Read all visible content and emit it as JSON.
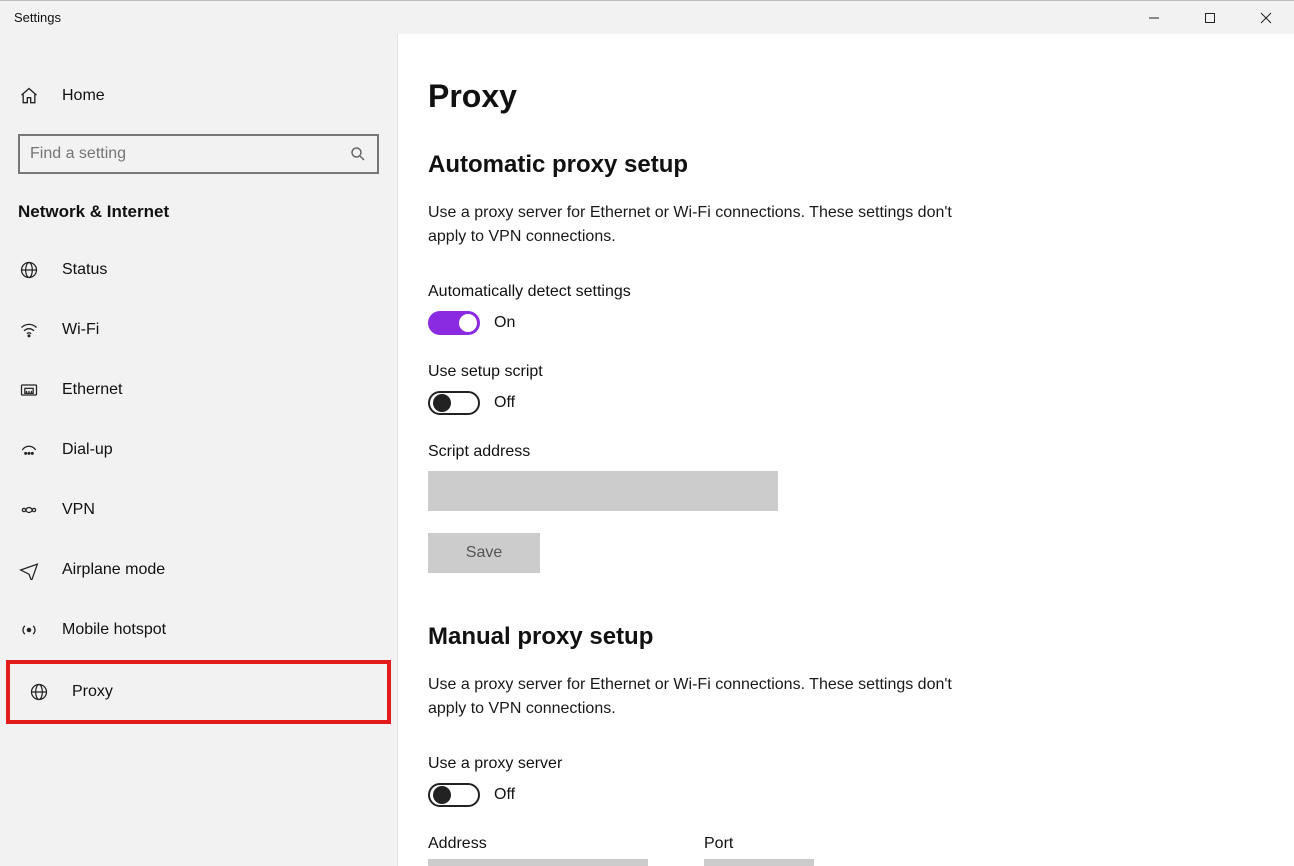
{
  "window": {
    "title": "Settings"
  },
  "sidebar": {
    "home": "Home",
    "search_placeholder": "Find a setting",
    "section": "Network & Internet",
    "items": [
      {
        "label": "Status"
      },
      {
        "label": "Wi-Fi"
      },
      {
        "label": "Ethernet"
      },
      {
        "label": "Dial-up"
      },
      {
        "label": "VPN"
      },
      {
        "label": "Airplane mode"
      },
      {
        "label": "Mobile hotspot"
      },
      {
        "label": "Proxy"
      }
    ]
  },
  "page": {
    "title": "Proxy",
    "auto": {
      "heading": "Automatic proxy setup",
      "desc": "Use a proxy server for Ethernet or Wi-Fi connections. These settings don't apply to VPN connections.",
      "detect_label": "Automatically detect settings",
      "detect_state": "On",
      "script_label": "Use setup script",
      "script_state": "Off",
      "script_addr_label": "Script address",
      "script_addr_value": "",
      "save_label": "Save"
    },
    "manual": {
      "heading": "Manual proxy setup",
      "desc": "Use a proxy server for Ethernet or Wi-Fi connections. These settings don't apply to VPN connections.",
      "use_label": "Use a proxy server",
      "use_state": "Off",
      "address_label": "Address",
      "port_label": "Port"
    }
  }
}
